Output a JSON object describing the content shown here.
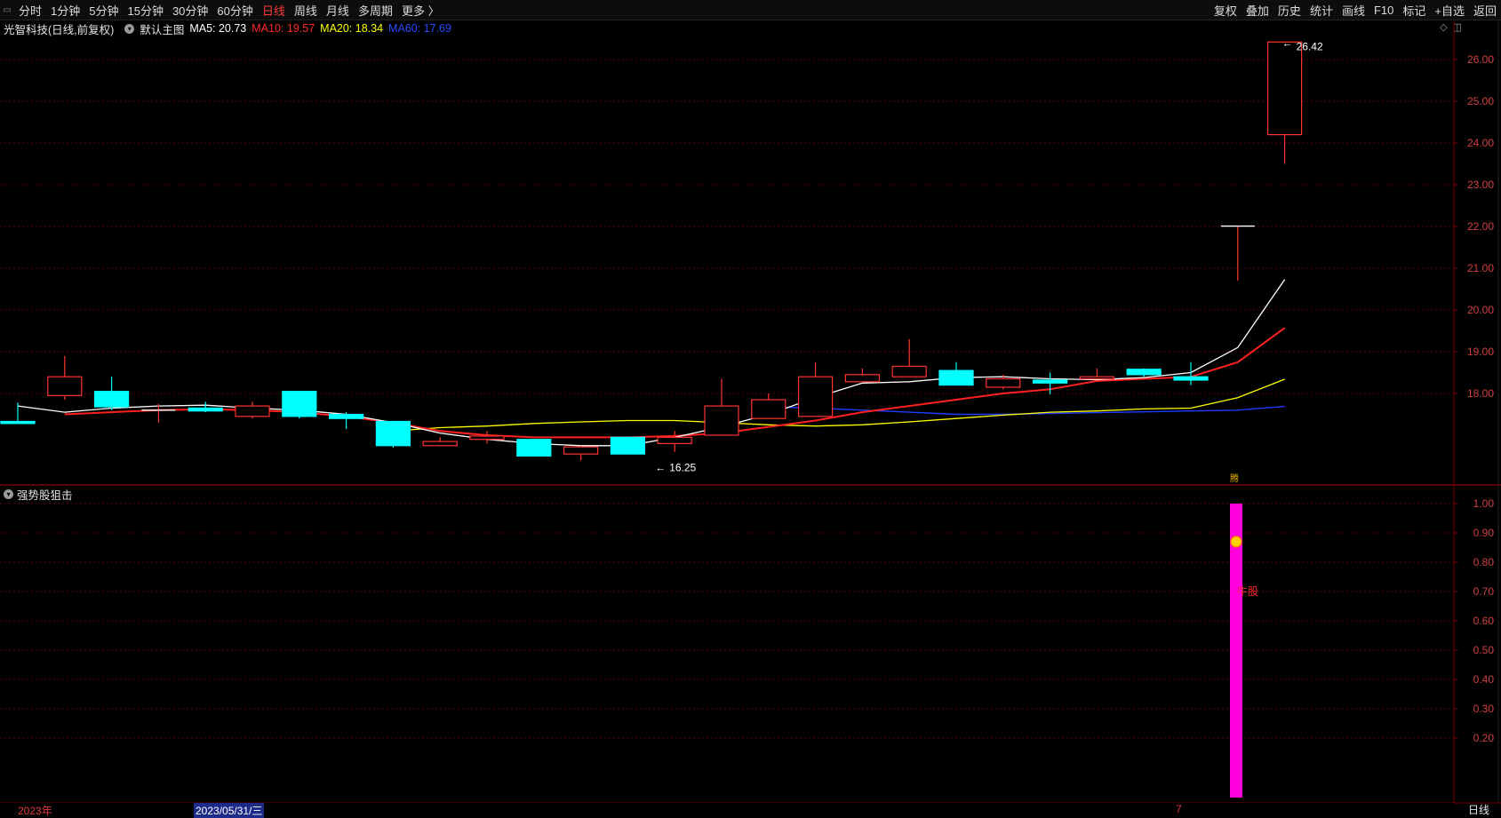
{
  "toolbar": {
    "periods": [
      "分时",
      "1分钟",
      "5分钟",
      "15分钟",
      "30分钟",
      "60分钟",
      "日线",
      "周线",
      "月线",
      "多周期",
      "更多 〉"
    ],
    "active_period": "日线",
    "actions": [
      "复权",
      "叠加",
      "历史",
      "统计",
      "画线",
      "F10",
      "标记",
      "+自选",
      "返回"
    ]
  },
  "info": {
    "stock_title": "光智科技(日线,前复权)",
    "main_chart": "默认主图",
    "ma5": "MA5: 20.73",
    "ma10": "MA10: 19.57",
    "ma20": "MA20: 18.34",
    "ma60": "MA60: 17.69"
  },
  "colors": {
    "up": "#ff3232",
    "down": "#00ffff",
    "ma5": "#ffffff",
    "ma10": "#ff2020",
    "ma20": "#ffff00",
    "ma60": "#1e3cff",
    "grid": "#7a0000",
    "indicator": "#ff00dc"
  },
  "price_axis": {
    "labels": [
      "26.00",
      "25.00",
      "24.00",
      "23.00",
      "22.00",
      "21.00",
      "20.00",
      "19.00",
      "18.00"
    ]
  },
  "annotations": {
    "high_label": "26.42",
    "low_label": "16.25",
    "signal_label": "牛股",
    "marker_label": "腾"
  },
  "indicator": {
    "title": "强势股狙击",
    "axis_labels": [
      "1.00",
      "0.90",
      "0.80",
      "0.70",
      "0.60",
      "0.50",
      "0.40",
      "0.30",
      "0.20"
    ],
    "signal_value": 1.0
  },
  "datebar": {
    "year": "2023年",
    "selected": "2023/05/31/三",
    "month": "7"
  },
  "period_tab": "日线",
  "chart_data": {
    "type": "candlestick",
    "candles": [
      {
        "o": 17.33,
        "c": 17.28,
        "h": 17.78,
        "l": 17.28
      },
      {
        "o": 17.95,
        "c": 18.4,
        "h": 18.9,
        "l": 17.85
      },
      {
        "o": 18.05,
        "c": 17.68,
        "h": 18.4,
        "l": 17.6
      },
      {
        "o": 17.6,
        "c": 17.6,
        "h": 17.75,
        "l": 17.3
      },
      {
        "o": 17.65,
        "c": 17.58,
        "h": 17.8,
        "l": 17.55
      },
      {
        "o": 17.45,
        "c": 17.7,
        "h": 17.8,
        "l": 17.4
      },
      {
        "o": 18.05,
        "c": 17.45,
        "h": 18.05,
        "l": 17.4
      },
      {
        "o": 17.5,
        "c": 17.4,
        "h": 17.55,
        "l": 17.15
      },
      {
        "o": 17.33,
        "c": 16.75,
        "h": 17.33,
        "l": 16.7
      },
      {
        "o": 16.75,
        "c": 16.85,
        "h": 16.95,
        "l": 16.75
      },
      {
        "o": 16.9,
        "c": 16.98,
        "h": 17.1,
        "l": 16.8
      },
      {
        "o": 16.9,
        "c": 16.5,
        "h": 16.9,
        "l": 16.5
      },
      {
        "o": 16.55,
        "c": 16.72,
        "h": 16.75,
        "l": 16.4
      },
      {
        "o": 16.95,
        "c": 16.55,
        "h": 16.95,
        "l": 16.55
      },
      {
        "o": 16.8,
        "c": 16.95,
        "h": 17.1,
        "l": 16.6
      },
      {
        "o": 17.0,
        "c": 17.7,
        "h": 18.35,
        "l": 17.0
      },
      {
        "o": 17.4,
        "c": 17.85,
        "h": 18.0,
        "l": 17.4
      },
      {
        "o": 17.45,
        "c": 18.4,
        "h": 18.75,
        "l": 17.45
      },
      {
        "o": 18.28,
        "c": 18.45,
        "h": 18.6,
        "l": 18.28
      },
      {
        "o": 18.4,
        "c": 18.65,
        "h": 19.3,
        "l": 18.4
      },
      {
        "o": 18.55,
        "c": 18.2,
        "h": 18.75,
        "l": 18.2
      },
      {
        "o": 18.15,
        "c": 18.35,
        "h": 18.45,
        "l": 18.1
      },
      {
        "o": 18.32,
        "c": 18.25,
        "h": 18.5,
        "l": 17.98
      },
      {
        "o": 18.35,
        "c": 18.4,
        "h": 18.6,
        "l": 18.35
      },
      {
        "o": 18.58,
        "c": 18.45,
        "h": 18.6,
        "l": 18.4
      },
      {
        "o": 18.4,
        "c": 18.32,
        "h": 18.75,
        "l": 18.2
      },
      {
        "o": 22.01,
        "c": 22.01,
        "h": 22.01,
        "l": 20.7
      },
      {
        "o": 24.2,
        "c": 26.42,
        "h": 26.42,
        "l": 23.5
      }
    ],
    "ma5": [
      17.7,
      17.55,
      17.65,
      17.7,
      17.72,
      17.65,
      17.6,
      17.5,
      17.3,
      17.05,
      16.9,
      16.8,
      16.75,
      16.75,
      16.95,
      17.2,
      17.5,
      17.9,
      18.25,
      18.28,
      18.38,
      18.4,
      18.35,
      18.33,
      18.38,
      18.5,
      19.1,
      20.73
    ],
    "ma10": [
      17.5,
      17.55,
      17.6,
      17.62,
      17.6,
      17.55,
      17.45,
      17.3,
      17.1,
      17.0,
      16.95,
      16.95,
      16.95,
      16.98,
      17.05,
      17.2,
      17.35,
      17.55,
      17.7,
      17.85,
      18.0,
      18.1,
      18.3,
      18.35,
      18.4,
      18.75,
      19.57
    ],
    "ma20": [
      17.1,
      17.18,
      17.22,
      17.28,
      17.32,
      17.35,
      17.35,
      17.3,
      17.25,
      17.22,
      17.25,
      17.32,
      17.4,
      17.48,
      17.55,
      17.58,
      17.63,
      17.65,
      17.9,
      18.34
    ],
    "ma60": [
      17.68,
      17.65,
      17.6,
      17.55,
      17.5,
      17.5,
      17.52,
      17.54,
      17.56,
      17.58,
      17.6,
      17.69
    ]
  }
}
